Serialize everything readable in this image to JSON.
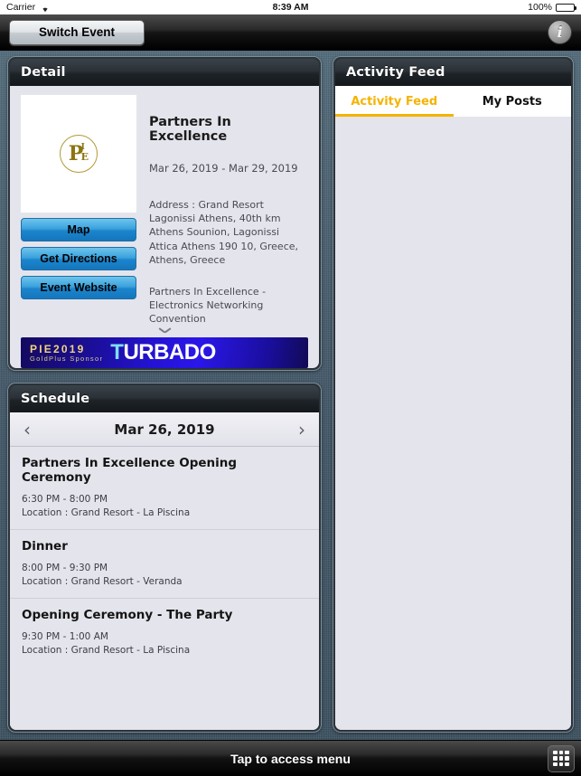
{
  "status_bar": {
    "carrier": "Carrier",
    "wifi_icon": "wifi-icon",
    "time": "8:39 AM",
    "battery_percent": "100%"
  },
  "nav_bar": {
    "switch_event_label": "Switch Event",
    "info_icon": "i"
  },
  "detail": {
    "header": "Detail",
    "logo_alt": "pie-logo",
    "logo_letters": {
      "p": "P",
      "i": "I",
      "e": "E"
    },
    "event_title": "Partners In Excellence",
    "event_dates": "Mar 26, 2019 - Mar 29, 2019",
    "address": "Address : Grand Resort Lagonissi Athens, 40th km Athens Sounion, Lagonissi Attica Athens 190 10, Greece, Athens, Greece",
    "description": "Partners In Excellence - Electronics Networking Convention",
    "buttons": [
      {
        "label": "Map",
        "name": "map-button"
      },
      {
        "label": "Get Directions",
        "name": "get-directions-button"
      },
      {
        "label": "Event Website",
        "name": "event-website-button"
      }
    ],
    "expand_icon": "chevron-down-icon",
    "sponsor": {
      "tier_title": "PIE2019",
      "tier_sub": "GoldPlus Sponsor",
      "brand_first": "T",
      "brand_rest": "URBADO"
    }
  },
  "schedule": {
    "header": "Schedule",
    "prev_icon": "‹",
    "next_icon": "›",
    "current_date": "Mar 26, 2019",
    "items": [
      {
        "title": "Partners In Excellence Opening Ceremony",
        "time": "6:30 PM - 8:00 PM",
        "location": "Location : Grand Resort - La Piscina"
      },
      {
        "title": "Dinner",
        "time": "8:00 PM - 9:30 PM",
        "location": "Location : Grand Resort - Veranda"
      },
      {
        "title": "Opening Ceremony - The Party",
        "time": "9:30 PM - 1:00 AM",
        "location": "Location : Grand Resort - La Piscina"
      }
    ]
  },
  "activity": {
    "header": "Activity Feed",
    "tabs": [
      {
        "label": "Activity Feed",
        "active": true
      },
      {
        "label": "My Posts",
        "active": false
      }
    ]
  },
  "bottom_bar": {
    "label": "Tap to access menu",
    "grid_icon": "grid-menu-icon"
  },
  "colors": {
    "accent_gold": "#f5b301",
    "button_blue": "#1c85cc",
    "panel_bg": "#e4e4ec",
    "chrome_dark": "#14181c"
  }
}
